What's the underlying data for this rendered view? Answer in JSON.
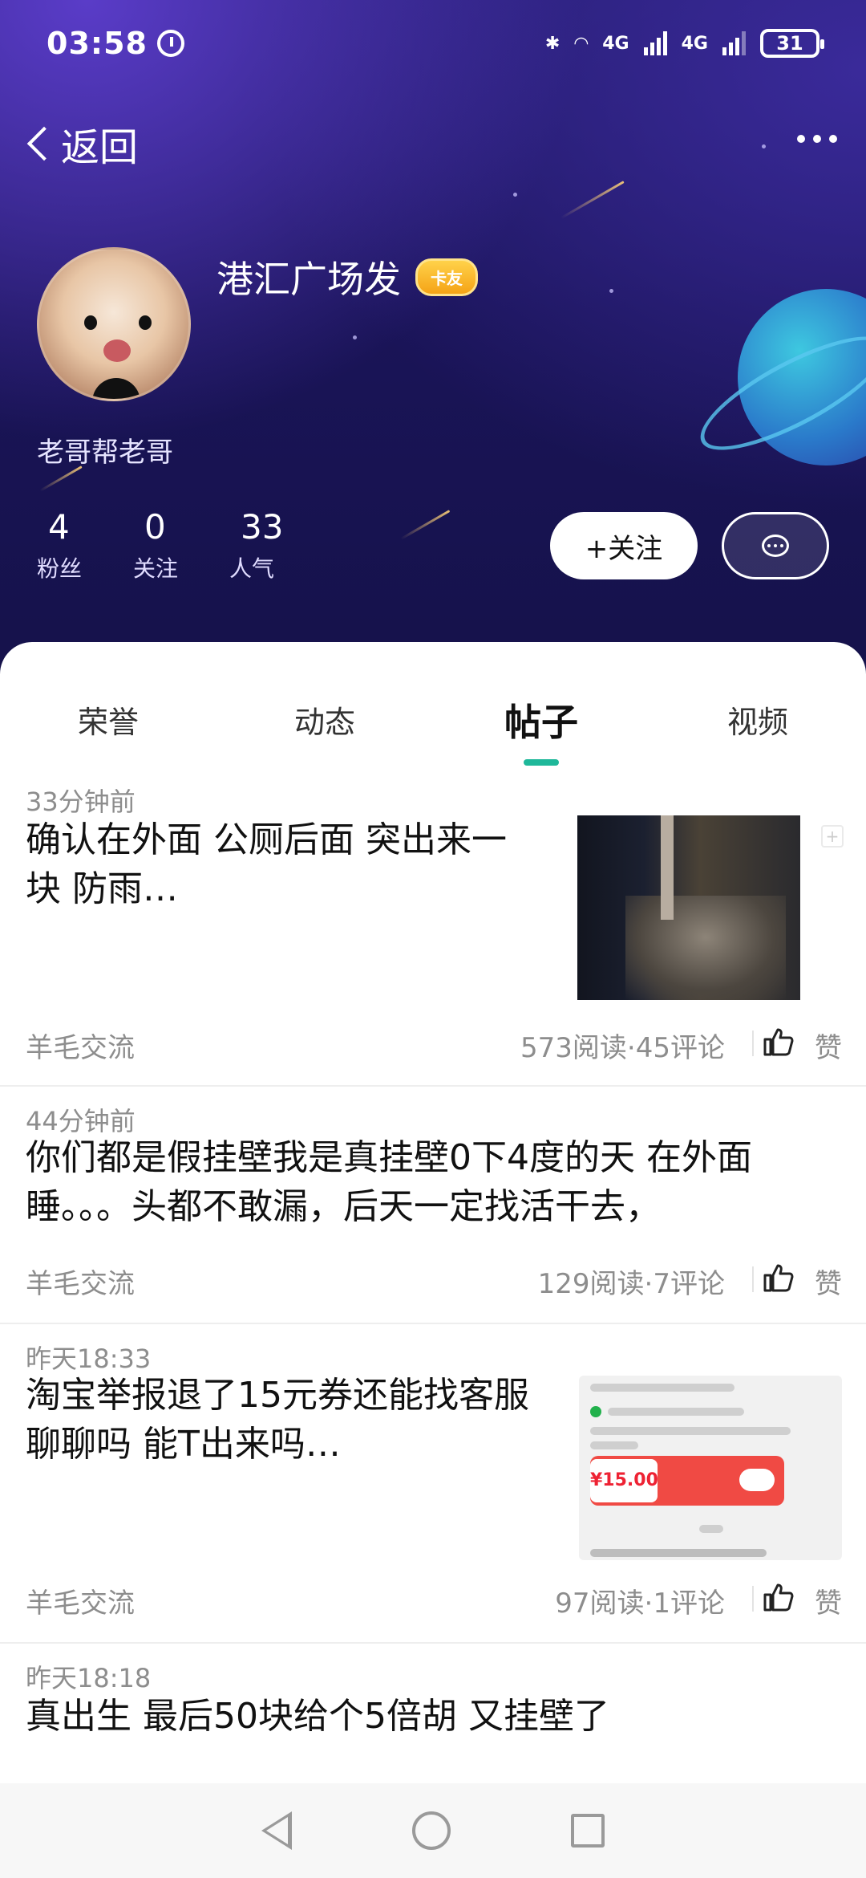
{
  "status_bar": {
    "time": "03:58",
    "network_1": "4G",
    "network_2": "4G",
    "battery": "31"
  },
  "header": {
    "back_label": "返回",
    "username": "港汇广场发",
    "badge": "卡友",
    "bio": "老哥帮老哥",
    "stats": [
      {
        "value": "4",
        "label": "粉丝"
      },
      {
        "value": "0",
        "label": "关注"
      },
      {
        "value": "33",
        "label": "人气"
      }
    ],
    "follow_label": "+关注",
    "accent_color": "#1fb89a"
  },
  "tabs": [
    {
      "label": "荣誉",
      "active": false
    },
    {
      "label": "动态",
      "active": false
    },
    {
      "label": "帖子",
      "active": true
    },
    {
      "label": "视频",
      "active": false
    }
  ],
  "posts": [
    {
      "time": "33分钟前",
      "title_line1": "确认在外面  公厕后面 突出来一",
      "title_line2": "块 防雨…",
      "tag": "羊毛交流",
      "meta": "573阅读·45评论",
      "like_label": "赞",
      "has_thumb": true
    },
    {
      "time": "44分钟前",
      "title_line1": "你们都是假挂壁我是真挂壁0下4度的天 在外面",
      "title_line2": "睡。。。头都不敢漏，后天一定找活干去，",
      "tag": "羊毛交流",
      "meta": "129阅读·7评论",
      "like_label": "赞",
      "has_thumb": false
    },
    {
      "time": "昨天18:33",
      "title_line1": "淘宝举报退了15元券还能找客服",
      "title_line2": "聊聊吗 能T出来吗…",
      "tag": "羊毛交流",
      "meta": "97阅读·1评论",
      "like_label": "赞",
      "has_thumb": true,
      "thumb_amount": "¥15.00"
    },
    {
      "time": "昨天18:18",
      "title_line1": "真出生 最后50块给个5倍胡 又挂壁了",
      "title_line2": ""
    }
  ]
}
